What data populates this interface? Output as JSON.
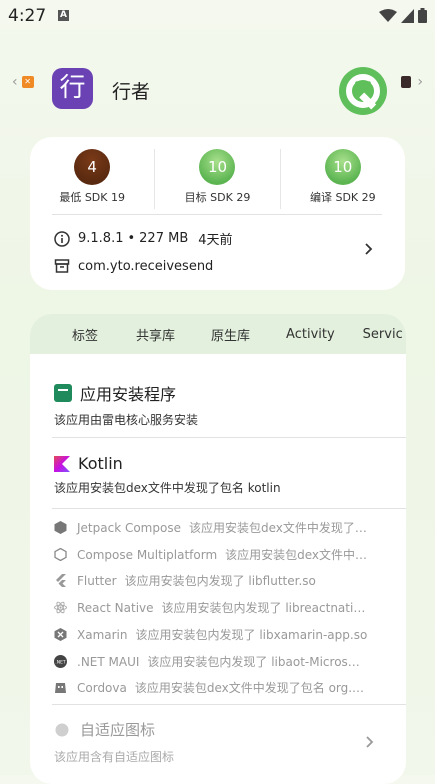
{
  "status": {
    "time": "4:27",
    "notif": "A"
  },
  "header": {
    "app_name": "行者",
    "app_icon_char": "行"
  },
  "sdk": [
    {
      "label": "最低 SDK 19",
      "value": "4"
    },
    {
      "label": "目标 SDK 29",
      "value": "10"
    },
    {
      "label": "编译 SDK 29",
      "value": "10"
    }
  ],
  "info": {
    "version": "9.1.8.1",
    "size": "227 MB",
    "date": "4天前",
    "package": "com.yto.receivesend"
  },
  "tabs": [
    "标签",
    "共享库",
    "原生库",
    "Activity",
    "Servic"
  ],
  "installer": {
    "title": "应用安装程序",
    "desc": "该应用由雷电核心服务安装"
  },
  "kotlin": {
    "title": "Kotlin",
    "desc": "该应用安装包dex文件中发现了包名 kotlin"
  },
  "libs": [
    {
      "name": "Jetpack Compose",
      "detail": "该应用安装包dex文件中发现了…",
      "icon": "jetpack-compose-icon"
    },
    {
      "name": "Compose Multiplatform",
      "detail": "该应用安装包dex文件中…",
      "icon": "compose-multiplatform-icon"
    },
    {
      "name": "Flutter",
      "detail": "该应用安装包内发现了 libflutter.so",
      "icon": "flutter-icon"
    },
    {
      "name": "React Native",
      "detail": "该应用安装包内发现了 libreactnati…",
      "icon": "react-icon"
    },
    {
      "name": "Xamarin",
      "detail": "该应用安装包内发现了 libxamarin-app.so",
      "icon": "xamarin-icon"
    },
    {
      "name": ".NET MAUI",
      "detail": "该应用安装包内发现了 libaot-Micros…",
      "icon": "dotnet-icon"
    },
    {
      "name": "Cordova",
      "detail": "该应用安装包dex文件中发现了包名 org.…",
      "icon": "cordova-icon"
    }
  ],
  "adaptive": {
    "title": "自适应图标",
    "desc": "该应用含有自适应图标"
  },
  "colors": {
    "accent_purple": "#6a42b4",
    "tab_bg": "#e3f0dd",
    "badge_green": "#5db552"
  }
}
